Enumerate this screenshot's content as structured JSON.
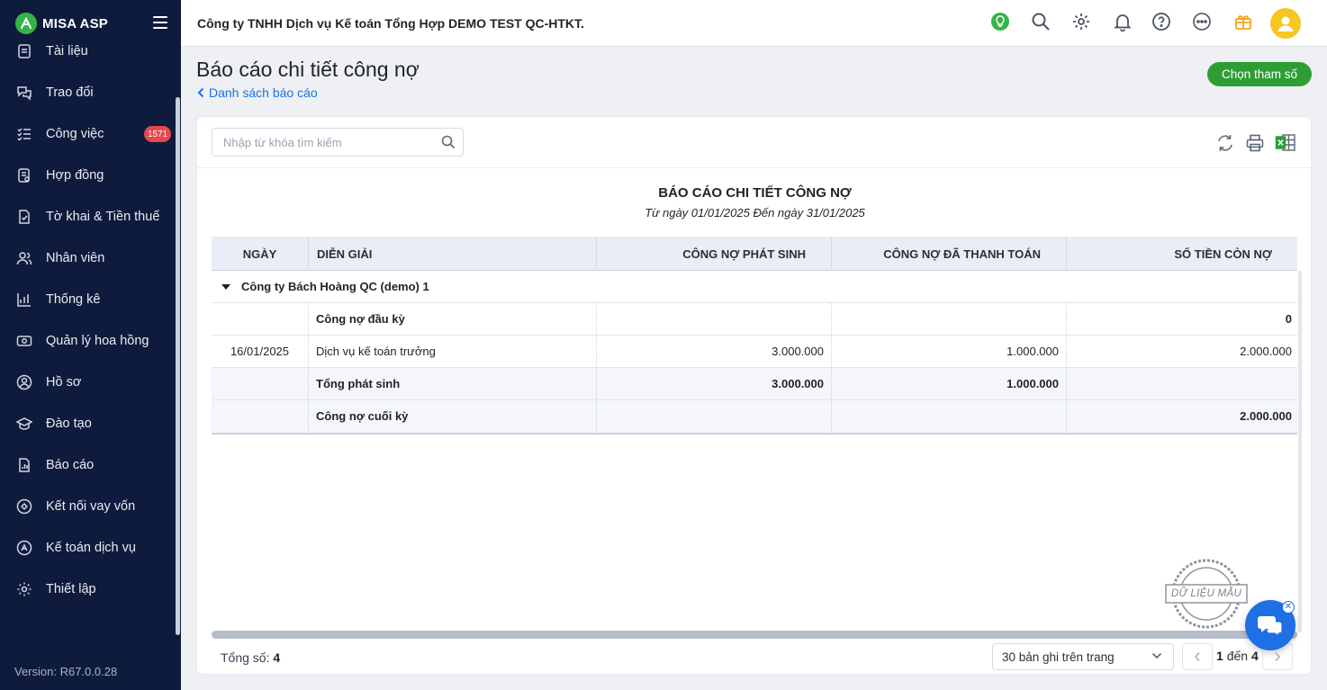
{
  "app": {
    "brand": "MISA ASP",
    "version": "Version: R67.0.0.28"
  },
  "sidebar": {
    "items": [
      {
        "label": "Tài liệu",
        "icon": "document-icon"
      },
      {
        "label": "Trao đổi",
        "icon": "chat-exchange-icon"
      },
      {
        "label": "Công việc",
        "icon": "task-list-icon",
        "badge": "1571"
      },
      {
        "label": "Hợp đồng",
        "icon": "contract-icon"
      },
      {
        "label": "Tờ khai & Tiền thuế",
        "icon": "tax-form-icon"
      },
      {
        "label": "Nhân viên",
        "icon": "staff-icon"
      },
      {
        "label": "Thống kê",
        "icon": "statistics-icon"
      },
      {
        "label": "Quản lý hoa hồng",
        "icon": "commission-icon"
      },
      {
        "label": "Hồ sơ",
        "icon": "profile-icon"
      },
      {
        "label": "Đào tạo",
        "icon": "training-icon"
      },
      {
        "label": "Báo cáo",
        "icon": "report-icon"
      },
      {
        "label": "Kết nối vay vốn",
        "icon": "loan-connect-icon"
      },
      {
        "label": "Kế toán dịch vụ",
        "icon": "accounting-service-icon"
      },
      {
        "label": "Thiết lập",
        "icon": "settings-icon"
      }
    ]
  },
  "topbar": {
    "company": "Công ty TNHH Dịch vụ Kế toán Tổng Hợp DEMO TEST QC-HTKT.",
    "icons": [
      "lightbulb-icon",
      "search-icon",
      "gear-icon",
      "bell-icon",
      "help-icon",
      "more-icon",
      "gift-icon"
    ]
  },
  "page": {
    "title": "Báo cáo chi tiết công nợ",
    "back_link": "Danh sách báo cáo",
    "params_button": "Chọn tham số"
  },
  "search": {
    "placeholder": "Nhập từ khóa tìm kiếm"
  },
  "report": {
    "title": "BÁO CÁO CHI TIẾT CÔNG NỢ",
    "subtitle": "Từ ngày 01/01/2025 Đến ngày 31/01/2025",
    "columns": [
      "NGÀY",
      "DIỄN GIẢI",
      "CÔNG NỢ PHÁT SINH",
      "CÔNG NỢ ĐÃ THANH TOÁN",
      "SỐ TIỀN CÒN NỢ"
    ],
    "group": "Công ty Bách Hoàng QC (demo) 1",
    "rows": [
      {
        "date": "",
        "desc": "Công nợ đầu kỳ",
        "incurred": "",
        "paid": "",
        "remaining": "0",
        "bold": true
      },
      {
        "date": "16/01/2025",
        "desc": "Dịch vụ kế toán trưởng",
        "incurred": "3.000.000",
        "paid": "1.000.000",
        "remaining": "2.000.000",
        "bold": false
      },
      {
        "date": "",
        "desc": "Tổng phát sinh",
        "incurred": "3.000.000",
        "paid": "1.000.000",
        "remaining": "",
        "bold": true
      },
      {
        "date": "",
        "desc": "Công nợ cuối kỳ",
        "incurred": "",
        "paid": "",
        "remaining": "2.000.000",
        "bold": true
      }
    ]
  },
  "footer": {
    "total_label": "Tổng số:",
    "total_value": "4",
    "page_size": "30 bản ghi trên trang",
    "range_start": "1",
    "range_word": "đến",
    "range_end": "4"
  },
  "stamp": {
    "text": "DỮ LIỆU MẪU"
  }
}
